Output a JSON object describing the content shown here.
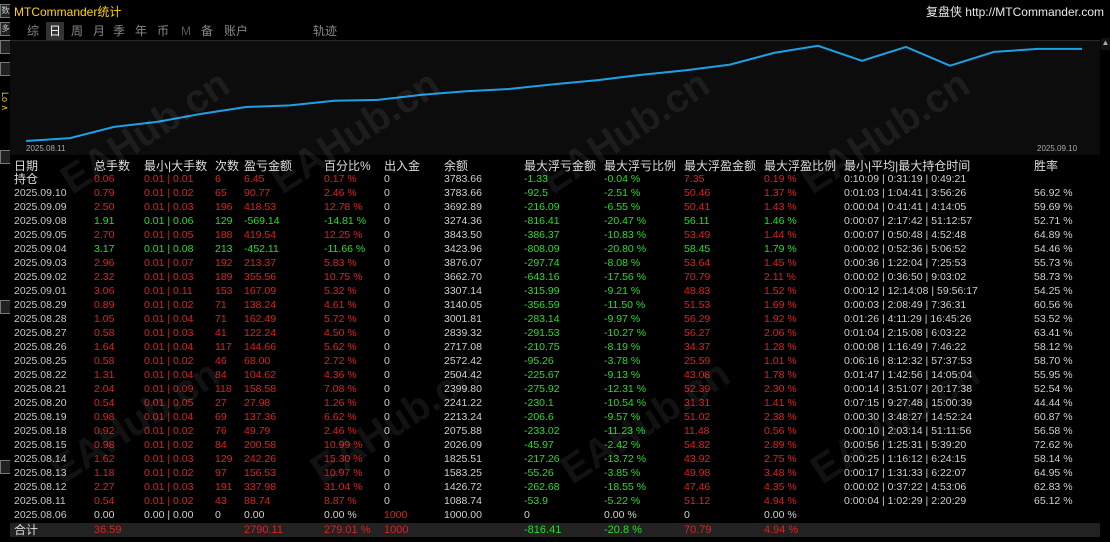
{
  "window": {
    "title": "MTCommander统计",
    "brand": "复盘侠 http://MTCommander.com"
  },
  "left_strip": {
    "buttons": [
      "数",
      "多",
      "",
      "",
      "",
      "",
      ""
    ],
    "vertical_label": "Lo ∧"
  },
  "tabs": [
    {
      "label": "综",
      "active": false,
      "dim": false
    },
    {
      "label": "日",
      "active": true,
      "dim": false
    },
    {
      "label": "周",
      "active": false,
      "dim": false
    },
    {
      "label": "月",
      "active": false,
      "dim": false
    },
    {
      "label": "季",
      "active": false,
      "dim": false
    },
    {
      "label": "年",
      "active": false,
      "dim": false
    },
    {
      "label": "币",
      "active": false,
      "dim": false
    },
    {
      "label": "M",
      "active": false,
      "dim": true
    },
    {
      "label": "备",
      "active": false,
      "dim": false
    },
    {
      "label": "账户",
      "active": false,
      "dim": false
    },
    {
      "label": "轨迹",
      "active": false,
      "dim": false
    }
  ],
  "chart_data": {
    "type": "line",
    "x_start_label": "2025.08.11",
    "x_end_label": "2025.09.10",
    "line_color": "#1ea0e6",
    "series": [
      {
        "values": [
          1000,
          1088.74,
          1426.72,
          1583.25,
          1825.51,
          2026.09,
          2075.88,
          2213.24,
          2241.22,
          2399.8,
          2504.42,
          2572.42,
          2717.08,
          2839.32,
          3001.81,
          3140.05,
          3307.14,
          3662.7,
          3876.07,
          3423.96,
          3843.5,
          3274.36,
          3692.89,
          3783.66,
          3783.66
        ]
      }
    ]
  },
  "table": {
    "headers": [
      "日期",
      "总手数",
      "最小|大手数",
      "次数",
      "盈亏金额",
      "百分比%",
      "出入金",
      "余额",
      "最大浮亏金额",
      "最大浮亏比例",
      "最大浮盈金额",
      "最大浮盈比例",
      "最小|平均|最大持仓时间",
      "胜率"
    ],
    "rows": [
      {
        "date": "持仓",
        "lots": "0.06",
        "minmax": "0.01 | 0.01",
        "count": "6",
        "pnl": "6.45",
        "pct": "0.17 %",
        "flow": "0",
        "balance": "3783.66",
        "maxloss": "-1.33",
        "maxloss_pct": "-0.04 %",
        "maxgain": "7.35",
        "maxgain_pct": "0.19 %",
        "time": "0:10:09 | 0:31:19 | 0:49:21",
        "win": "",
        "color": "red"
      },
      {
        "date": "2025.09.10",
        "lots": "0.79",
        "minmax": "0.01 | 0.02",
        "count": "65",
        "pnl": "90.77",
        "pct": "2.46 %",
        "flow": "0",
        "balance": "3783.66",
        "maxloss": "-92.5",
        "maxloss_pct": "-2.51 %",
        "maxgain": "50.46",
        "maxgain_pct": "1.37 %",
        "time": "0:01:03 | 1:04:41 | 3:56:26",
        "win": "56.92 %",
        "color": "red"
      },
      {
        "date": "2025.09.09",
        "lots": "2.50",
        "minmax": "0.01 | 0.03",
        "count": "196",
        "pnl": "418.53",
        "pct": "12.78 %",
        "flow": "0",
        "balance": "3692.89",
        "maxloss": "-216.09",
        "maxloss_pct": "-6.55 %",
        "maxgain": "50.41",
        "maxgain_pct": "1.43 %",
        "time": "0:00:04 | 0:41:41 | 4:14:05",
        "win": "59.69 %",
        "color": "red"
      },
      {
        "date": "2025.09.08",
        "lots": "1.91",
        "minmax": "0.01 | 0.06",
        "count": "129",
        "pnl": "-569.14",
        "pct": "-14.81 %",
        "flow": "0",
        "balance": "3274.36",
        "maxloss": "-816.41",
        "maxloss_pct": "-20.47 %",
        "maxgain": "56.11",
        "maxgain_pct": "1.46 %",
        "time": "0:00:07 | 2:17:42 | 51:12:57",
        "win": "52.71 %",
        "color": "green"
      },
      {
        "date": "2025.09.05",
        "lots": "2.70",
        "minmax": "0.01 | 0.05",
        "count": "188",
        "pnl": "419.54",
        "pct": "12.25 %",
        "flow": "0",
        "balance": "3843.50",
        "maxloss": "-386.37",
        "maxloss_pct": "-10.83 %",
        "maxgain": "53.49",
        "maxgain_pct": "1.44 %",
        "time": "0:00:07 | 0:50:48 | 4:52:48",
        "win": "64.89 %",
        "color": "red"
      },
      {
        "date": "2025.09.04",
        "lots": "3.17",
        "minmax": "0.01 | 0.08",
        "count": "213",
        "pnl": "-452.11",
        "pct": "-11.66 %",
        "flow": "0",
        "balance": "3423.96",
        "maxloss": "-808.09",
        "maxloss_pct": "-20.80 %",
        "maxgain": "58.45",
        "maxgain_pct": "1.79 %",
        "time": "0:00:02 | 0:52:36 | 5:06:52",
        "win": "54.46 %",
        "color": "green"
      },
      {
        "date": "2025.09.03",
        "lots": "2.96",
        "minmax": "0.01 | 0.07",
        "count": "192",
        "pnl": "213.37",
        "pct": "5.83 %",
        "flow": "0",
        "balance": "3876.07",
        "maxloss": "-297.74",
        "maxloss_pct": "-8.08 %",
        "maxgain": "53.64",
        "maxgain_pct": "1.45 %",
        "time": "0:00:36 | 1:22:04 | 7:25:53",
        "win": "55.73 %",
        "color": "red"
      },
      {
        "date": "2025.09.02",
        "lots": "2.32",
        "minmax": "0.01 | 0.03",
        "count": "189",
        "pnl": "355.56",
        "pct": "10.75 %",
        "flow": "0",
        "balance": "3662.70",
        "maxloss": "-643.16",
        "maxloss_pct": "-17.56 %",
        "maxgain": "70.79",
        "maxgain_pct": "2.11 %",
        "time": "0:00:02 | 0:36:50 | 9:03:02",
        "win": "58.73 %",
        "color": "red"
      },
      {
        "date": "2025.09.01",
        "lots": "3.06",
        "minmax": "0.01 | 0.11",
        "count": "153",
        "pnl": "167.09",
        "pct": "5.32 %",
        "flow": "0",
        "balance": "3307.14",
        "maxloss": "-315.99",
        "maxloss_pct": "-9.21 %",
        "maxgain": "48.83",
        "maxgain_pct": "1.52 %",
        "time": "0:00:12 | 12:14:08 | 59:56:17",
        "win": "54.25 %",
        "color": "red"
      },
      {
        "date": "2025.08.29",
        "lots": "0.89",
        "minmax": "0.01 | 0.02",
        "count": "71",
        "pnl": "138.24",
        "pct": "4.61 %",
        "flow": "0",
        "balance": "3140.05",
        "maxloss": "-356.59",
        "maxloss_pct": "-11.50 %",
        "maxgain": "51.53",
        "maxgain_pct": "1.69 %",
        "time": "0:00:03 | 2:08:49 | 7:36:31",
        "win": "60.56 %",
        "color": "red"
      },
      {
        "date": "2025.08.28",
        "lots": "1.05",
        "minmax": "0.01 | 0.04",
        "count": "71",
        "pnl": "162.49",
        "pct": "5.72 %",
        "flow": "0",
        "balance": "3001.81",
        "maxloss": "-283.14",
        "maxloss_pct": "-9.97 %",
        "maxgain": "56.29",
        "maxgain_pct": "1.92 %",
        "time": "0:01:26 | 4:11:29 | 16:45:26",
        "win": "53.52 %",
        "color": "red"
      },
      {
        "date": "2025.08.27",
        "lots": "0.58",
        "minmax": "0.01 | 0.03",
        "count": "41",
        "pnl": "122.24",
        "pct": "4.50 %",
        "flow": "0",
        "balance": "2839.32",
        "maxloss": "-291.53",
        "maxloss_pct": "-10.27 %",
        "maxgain": "56.27",
        "maxgain_pct": "2.06 %",
        "time": "0:01:04 | 2:15:08 | 6:03:22",
        "win": "63.41 %",
        "color": "red"
      },
      {
        "date": "2025.08.26",
        "lots": "1.64",
        "minmax": "0.01 | 0.04",
        "count": "117",
        "pnl": "144.66",
        "pct": "5.62 %",
        "flow": "0",
        "balance": "2717.08",
        "maxloss": "-210.75",
        "maxloss_pct": "-8.19 %",
        "maxgain": "34.37",
        "maxgain_pct": "1.28 %",
        "time": "0:00:08 | 1:16:49 | 7:46:22",
        "win": "58.12 %",
        "color": "red"
      },
      {
        "date": "2025.08.25",
        "lots": "0.58",
        "minmax": "0.01 | 0.02",
        "count": "46",
        "pnl": "68.00",
        "pct": "2.72 %",
        "flow": "0",
        "balance": "2572.42",
        "maxloss": "-95.26",
        "maxloss_pct": "-3.78 %",
        "maxgain": "25.59",
        "maxgain_pct": "1.01 %",
        "time": "0:06:16 | 8:12:32 | 57:37:53",
        "win": "58.70 %",
        "color": "red"
      },
      {
        "date": "2025.08.22",
        "lots": "1.31",
        "minmax": "0.01 | 0.04",
        "count": "84",
        "pnl": "104.62",
        "pct": "4.36 %",
        "flow": "0",
        "balance": "2504.42",
        "maxloss": "-225.67",
        "maxloss_pct": "-9.13 %",
        "maxgain": "43.08",
        "maxgain_pct": "1.78 %",
        "time": "0:01:47 | 1:42:56 | 14:05:04",
        "win": "55.95 %",
        "color": "red"
      },
      {
        "date": "2025.08.21",
        "lots": "2.04",
        "minmax": "0.01 | 0.09",
        "count": "118",
        "pnl": "158.58",
        "pct": "7.08 %",
        "flow": "0",
        "balance": "2399.80",
        "maxloss": "-275.92",
        "maxloss_pct": "-12.31 %",
        "maxgain": "52.39",
        "maxgain_pct": "2.30 %",
        "time": "0:00:14 | 3:51:07 | 20:17:38",
        "win": "52.54 %",
        "color": "red"
      },
      {
        "date": "2025.08.20",
        "lots": "0.54",
        "minmax": "0.01 | 0.05",
        "count": "27",
        "pnl": "27.98",
        "pct": "1.26 %",
        "flow": "0",
        "balance": "2241.22",
        "maxloss": "-230.1",
        "maxloss_pct": "-10.54 %",
        "maxgain": "31.31",
        "maxgain_pct": "1.41 %",
        "time": "0:07:15 | 9:27:48 | 15:00:39",
        "win": "44.44 %",
        "color": "red"
      },
      {
        "date": "2025.08.19",
        "lots": "0.98",
        "minmax": "0.01 | 0.04",
        "count": "69",
        "pnl": "137.36",
        "pct": "6.62 %",
        "flow": "0",
        "balance": "2213.24",
        "maxloss": "-206.6",
        "maxloss_pct": "-9.57 %",
        "maxgain": "51.02",
        "maxgain_pct": "2.38 %",
        "time": "0:00:30 | 3:48:27 | 14:52:24",
        "win": "60.87 %",
        "color": "red"
      },
      {
        "date": "2025.08.18",
        "lots": "0.92",
        "minmax": "0.01 | 0.02",
        "count": "76",
        "pnl": "49.79",
        "pct": "2.46 %",
        "flow": "0",
        "balance": "2075.88",
        "maxloss": "-233.02",
        "maxloss_pct": "-11.23 %",
        "maxgain": "11.48",
        "maxgain_pct": "0.56 %",
        "time": "0:00:10 | 2:03:14 | 51:11:56",
        "win": "56.58 %",
        "color": "red"
      },
      {
        "date": "2025.08.15",
        "lots": "0.98",
        "minmax": "0.01 | 0.02",
        "count": "84",
        "pnl": "200.58",
        "pct": "10.99 %",
        "flow": "0",
        "balance": "2026.09",
        "maxloss": "-45.97",
        "maxloss_pct": "-2.42 %",
        "maxgain": "54.82",
        "maxgain_pct": "2.89 %",
        "time": "0:00:56 | 1:25:31 | 5:39:20",
        "win": "72.62 %",
        "color": "red"
      },
      {
        "date": "2025.08.14",
        "lots": "1.62",
        "minmax": "0.01 | 0.03",
        "count": "129",
        "pnl": "242.26",
        "pct": "15.30 %",
        "flow": "0",
        "balance": "1825.51",
        "maxloss": "-217.26",
        "maxloss_pct": "-13.72 %",
        "maxgain": "43.92",
        "maxgain_pct": "2.75 %",
        "time": "0:00:25 | 1:16:12 | 6:24:15",
        "win": "58.14 %",
        "color": "red"
      },
      {
        "date": "2025.08.13",
        "lots": "1.18",
        "minmax": "0.01 | 0.02",
        "count": "97",
        "pnl": "156.53",
        "pct": "10.97 %",
        "flow": "0",
        "balance": "1583.25",
        "maxloss": "-55.26",
        "maxloss_pct": "-3.85 %",
        "maxgain": "49.98",
        "maxgain_pct": "3.48 %",
        "time": "0:00:17 | 1:31:33 | 6:22:07",
        "win": "64.95 %",
        "color": "red"
      },
      {
        "date": "2025.08.12",
        "lots": "2.27",
        "minmax": "0.01 | 0.03",
        "count": "191",
        "pnl": "337.98",
        "pct": "31.04 %",
        "flow": "0",
        "balance": "1426.72",
        "maxloss": "-262.68",
        "maxloss_pct": "-18.55 %",
        "maxgain": "47.46",
        "maxgain_pct": "4.35 %",
        "time": "0:00:02 | 0:37:22 | 4:53:06",
        "win": "62.83 %",
        "color": "red"
      },
      {
        "date": "2025.08.11",
        "lots": "0.54",
        "minmax": "0.01 | 0.02",
        "count": "43",
        "pnl": "88.74",
        "pct": "8.87 %",
        "flow": "0",
        "balance": "1088.74",
        "maxloss": "-53.9",
        "maxloss_pct": "-5.22 %",
        "maxgain": "51.12",
        "maxgain_pct": "4.94 %",
        "time": "0:00:04 | 1:02:29 | 2:20:29",
        "win": "65.12 %",
        "color": "red"
      },
      {
        "date": "2025.08.06",
        "lots": "0.00",
        "minmax": "0.00 | 0.00",
        "count": "0",
        "pnl": "0.00",
        "pct": "0.00 %",
        "flow": "1000",
        "balance": "1000.00",
        "maxloss": "0",
        "maxloss_pct": "0.00 %",
        "maxgain": "0",
        "maxgain_pct": "0.00 %",
        "time": "",
        "win": "",
        "color": "white"
      }
    ],
    "total": {
      "date": "合计",
      "lots": "36.59",
      "minmax": "",
      "count": "",
      "pnl": "2790.11",
      "pct": "279.01 %",
      "flow": "1000",
      "balance": "",
      "maxloss": "-816.41",
      "maxloss_pct": "-20.8 %",
      "maxgain": "70.79",
      "maxgain_pct": "4.94 %",
      "time": "",
      "win": ""
    }
  },
  "watermark": "EAHub.cn",
  "colors": {
    "profit": "#e02020",
    "loss": "#22e022",
    "accent": "#ffd400",
    "line": "#1ea0e6"
  }
}
